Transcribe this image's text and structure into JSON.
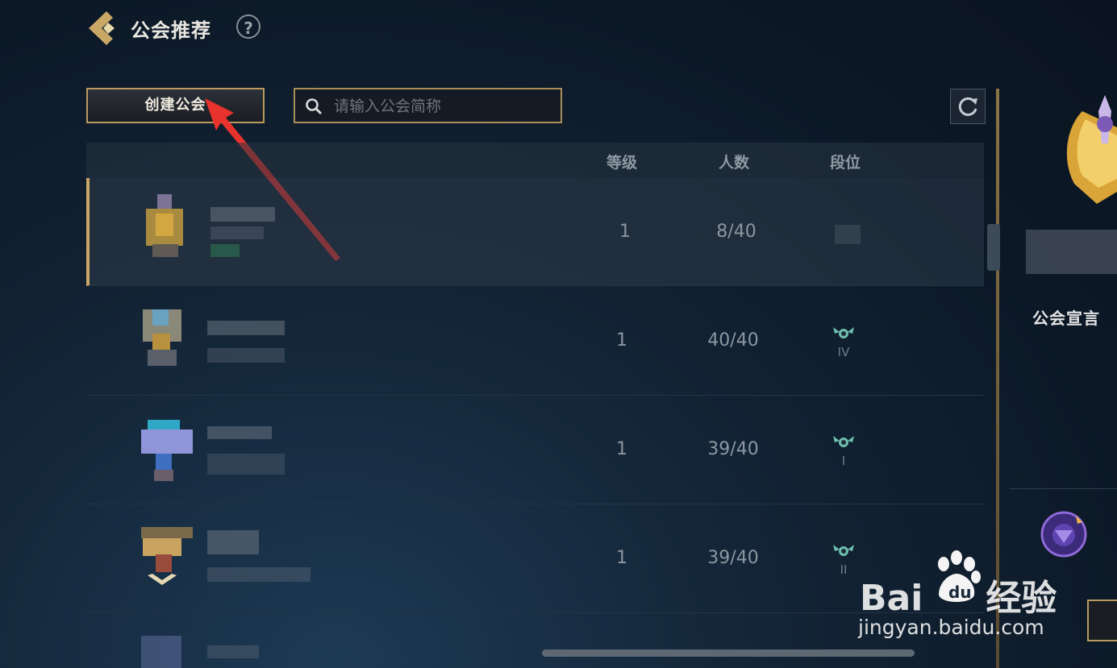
{
  "header": {
    "title": "公会推荐",
    "help": "?"
  },
  "toolbar": {
    "create_label": "创建公会",
    "search_placeholder": "请输入公会简称"
  },
  "table": {
    "columns": [
      "等级",
      "人数",
      "段位"
    ],
    "rows": [
      {
        "level": "1",
        "members": "8/40",
        "rank": ""
      },
      {
        "level": "1",
        "members": "40/40",
        "rank": "IV"
      },
      {
        "level": "1",
        "members": "39/40",
        "rank": "I"
      },
      {
        "level": "1",
        "members": "39/40",
        "rank": "II"
      }
    ]
  },
  "right_panel": {
    "manifesto_title": "公会宣言"
  },
  "side_id": "1099493",
  "watermark": {
    "brand_a": "Bai",
    "brand_b": "经验",
    "url": "jingyan.baidu.com"
  },
  "colors": {
    "accent_gold": "#c9a866",
    "background": "#0c1826"
  }
}
